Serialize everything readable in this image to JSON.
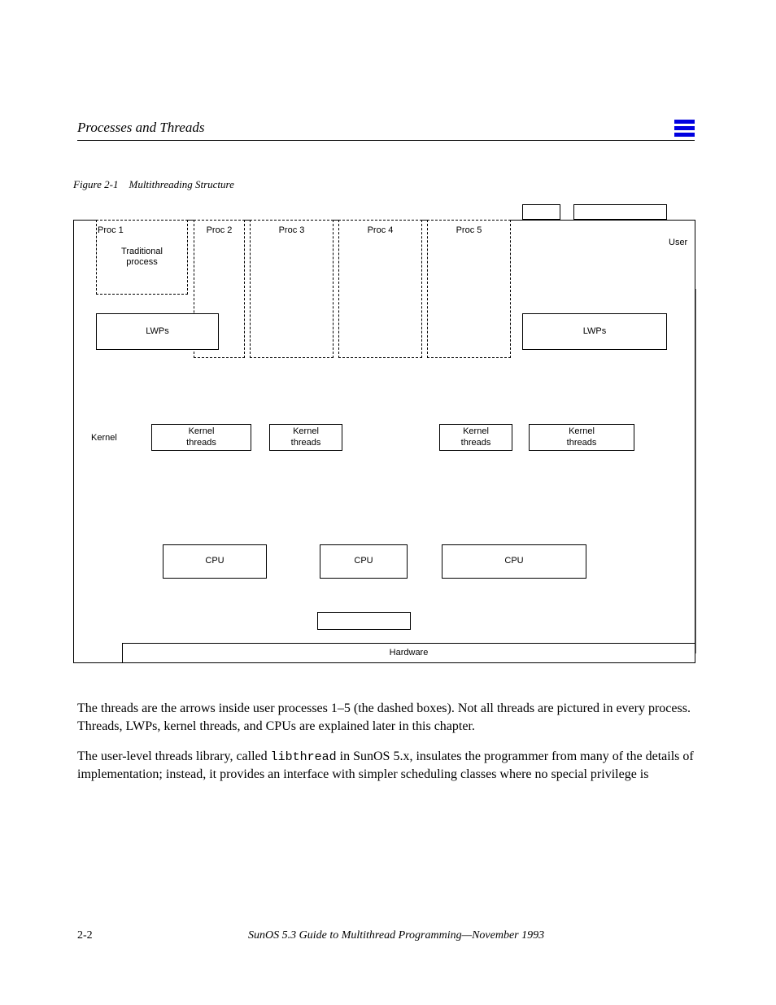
{
  "header": {
    "title": "Processes and Threads"
  },
  "menu_icon": "menu-icon",
  "figure": {
    "num": "Figure 2-1",
    "name": "Multithreading Structure"
  },
  "boxes": {
    "traditional": "Traditional\nprocess",
    "proc1": "Proc 1",
    "proc2": "Proc 2",
    "proc3": "Proc 3",
    "proc4": "Proc 4",
    "proc5": "Proc 5",
    "user": "User",
    "lwp_left": "LWPs",
    "lwp_right": "LWPs",
    "kt_left": "Kernel\nthreads",
    "kt_mid": "Kernel\nthreads",
    "kt_r1": "Kernel\nthreads",
    "kt_r2": "Kernel\nthreads",
    "kernel": "Kernel",
    "cpu_left": "CPU",
    "cpu_mid": "CPU",
    "cpu_right": "CPU",
    "hardware": "Hardware"
  },
  "caption": {
    "p1": "The threads are the arrows inside user processes 1–5 (the dashed boxes). Not all threads are pictured in every process. Threads, LWPs, kernel threads, and CPUs are explained later in this chapter.",
    "p2_pre": "The user-level threads library, called ",
    "p2_code": "libthread",
    "p2_post": " in SunOS 5.x, insulates the programmer from many of the details of implementation; instead, it provides an interface with simpler scheduling classes where no special privilege is"
  },
  "footer": {
    "left": "2-2",
    "right": "SunOS 5.3 Guide to Multithread Programming—November 1993"
  }
}
